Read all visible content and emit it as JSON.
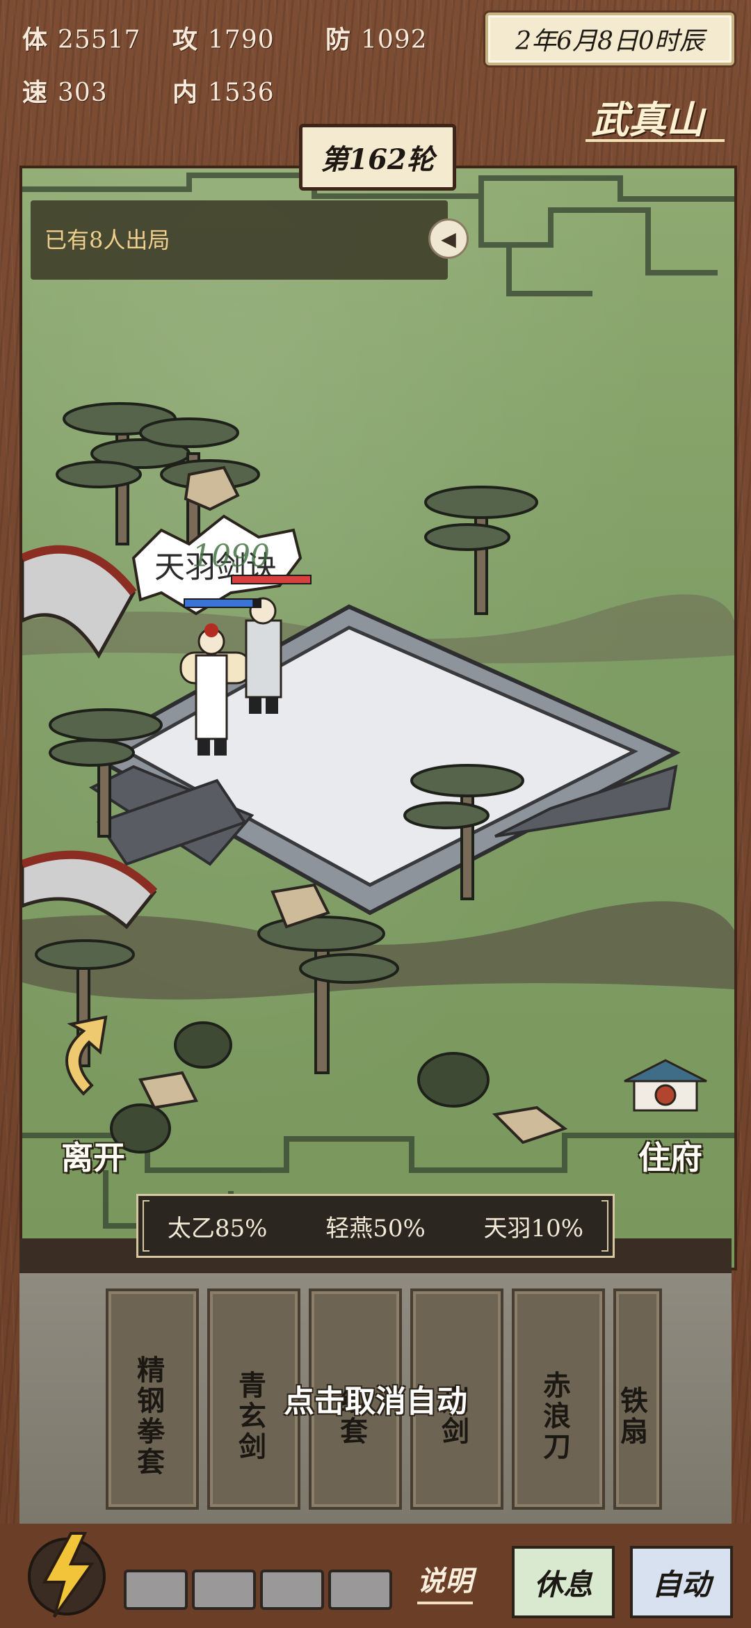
{
  "stats": {
    "hp": {
      "label": "体",
      "value": "25517"
    },
    "atk": {
      "label": "攻",
      "value": "1790"
    },
    "def": {
      "label": "防",
      "value": "1092"
    },
    "spd": {
      "label": "速",
      "value": "303"
    },
    "inner": {
      "label": "内",
      "value": "1536"
    }
  },
  "date": "2年6月8日0时辰",
  "location": "武真山",
  "round": "第162轮",
  "battle_log": "已有8人出局",
  "skill_name_popup": "天羽剑诀",
  "damage_number": "1090",
  "player_hp_fraction": 0.9,
  "enemy_hp_fraction": 1.0,
  "nav": {
    "leave": "离开",
    "residence": "住府"
  },
  "skills": [
    {
      "name": "太乙",
      "rate": "85%"
    },
    {
      "name": "轻燕",
      "rate": "50%"
    },
    {
      "name": "天羽",
      "rate": "10%"
    }
  ],
  "weapons": [
    "精钢拳套",
    "青玄剑",
    "纱套",
    "荆剑",
    "赤浪刀",
    "铁扇"
  ],
  "auto_overlay": "点击取消自动",
  "energy_slots": 4,
  "buttons": {
    "help": "说明",
    "rest": "休息",
    "auto": "自动"
  },
  "colors": {
    "accent": "#f0cf8d",
    "player_hp": "#3a74d6",
    "enemy_hp": "#d8403d",
    "rest_bg": "#d9e9cf",
    "auto_bg": "#d8e1ef"
  }
}
